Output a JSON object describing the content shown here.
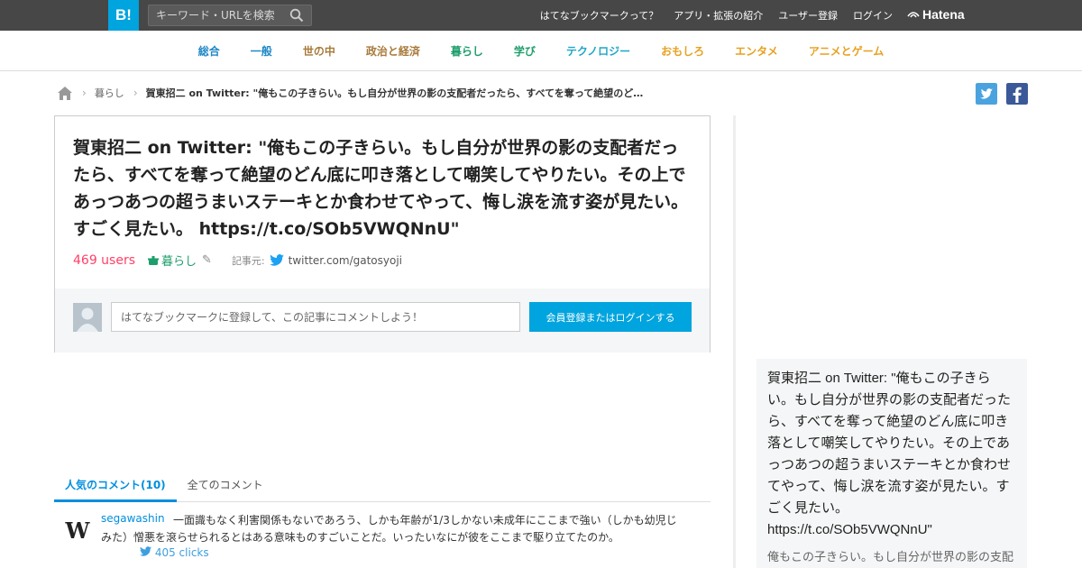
{
  "header": {
    "logo": "B!",
    "search_placeholder": "キーワード・URLを検索",
    "nav": [
      "はてなブックマークって？",
      "アプリ・拡張の紹介",
      "ユーザー登録",
      "ログイン"
    ],
    "brand": "Hatena"
  },
  "categories": [
    {
      "label": "総合",
      "color": "#1e88c7"
    },
    {
      "label": "一般",
      "color": "#1e88c7"
    },
    {
      "label": "世の中",
      "color": "#a87a3a"
    },
    {
      "label": "政治と経済",
      "color": "#a87a3a"
    },
    {
      "label": "暮らし",
      "color": "#1e9e6c"
    },
    {
      "label": "学び",
      "color": "#1e9e6c"
    },
    {
      "label": "テクノロジー",
      "color": "#1fa6c9"
    },
    {
      "label": "おもしろ",
      "color": "#e8a020"
    },
    {
      "label": "エンタメ",
      "color": "#e8a020"
    },
    {
      "label": "アニメとゲーム",
      "color": "#e8a020"
    }
  ],
  "breadcrumb": {
    "category": "暮らし",
    "current": "賀東招二 on Twitter: \"俺もこの子きらい。もし自分が世界の影の支配者だったら、すべてを奪って絶望のど…"
  },
  "entry": {
    "title": "賀東招二 on Twitter: \"俺もこの子きらい。もし自分が世界の影の支配者だったら、すべてを奪って絶望のどん底に叩き落として嘲笑してやりたい。その上であっつあつの超うまいステーキとか食わせてやって、悔し涙を流す姿が見たい。すごく見たい。 https://t.co/SOb5VWQNnU\"",
    "users": "469 users",
    "tag": "暮らし",
    "source_label": "記事元:",
    "source": "twitter.com/gatosyoji",
    "comment_placeholder": "はてなブックマークに登録して、この記事にコメントしよう！",
    "login_button": "会員登録またはログインする"
  },
  "sidebar": {
    "title": "賀東招二 on Twitter: \"俺もこの子きらい。もし自分が世界の影の支配者だったら、すべてを奪って絶望のどん底に叩き落として嘲笑してやりたい。その上であっつあつの超うまいステーキとか食わせてやって、悔し涙を流す姿が見たい。すごく見たい。 https://t.co/SOb5VWQNnU\"",
    "desc": "俺もこの子きらい。もし自分が世界の影の支配者だったら"
  },
  "comments": {
    "tabs": [
      "人気のコメント(10)",
      "全てのコメント"
    ],
    "items": [
      {
        "user": "segawashin",
        "avatar": "W",
        "text": "一面識もなく利害関係もないであろう、しかも年齢が1/3しかない未成年にここまで強い（しかも幼児じみた）憎悪を滾らせられるとはある意味ものすごいことだ。いったいなにが彼をここまで駆り立てたのか。",
        "clicks": "405 clicks"
      }
    ]
  },
  "colors": {
    "accent": "#00a4de",
    "users": "#ff4166",
    "twitter": "#1da1f2",
    "facebook": "#3b5998"
  }
}
